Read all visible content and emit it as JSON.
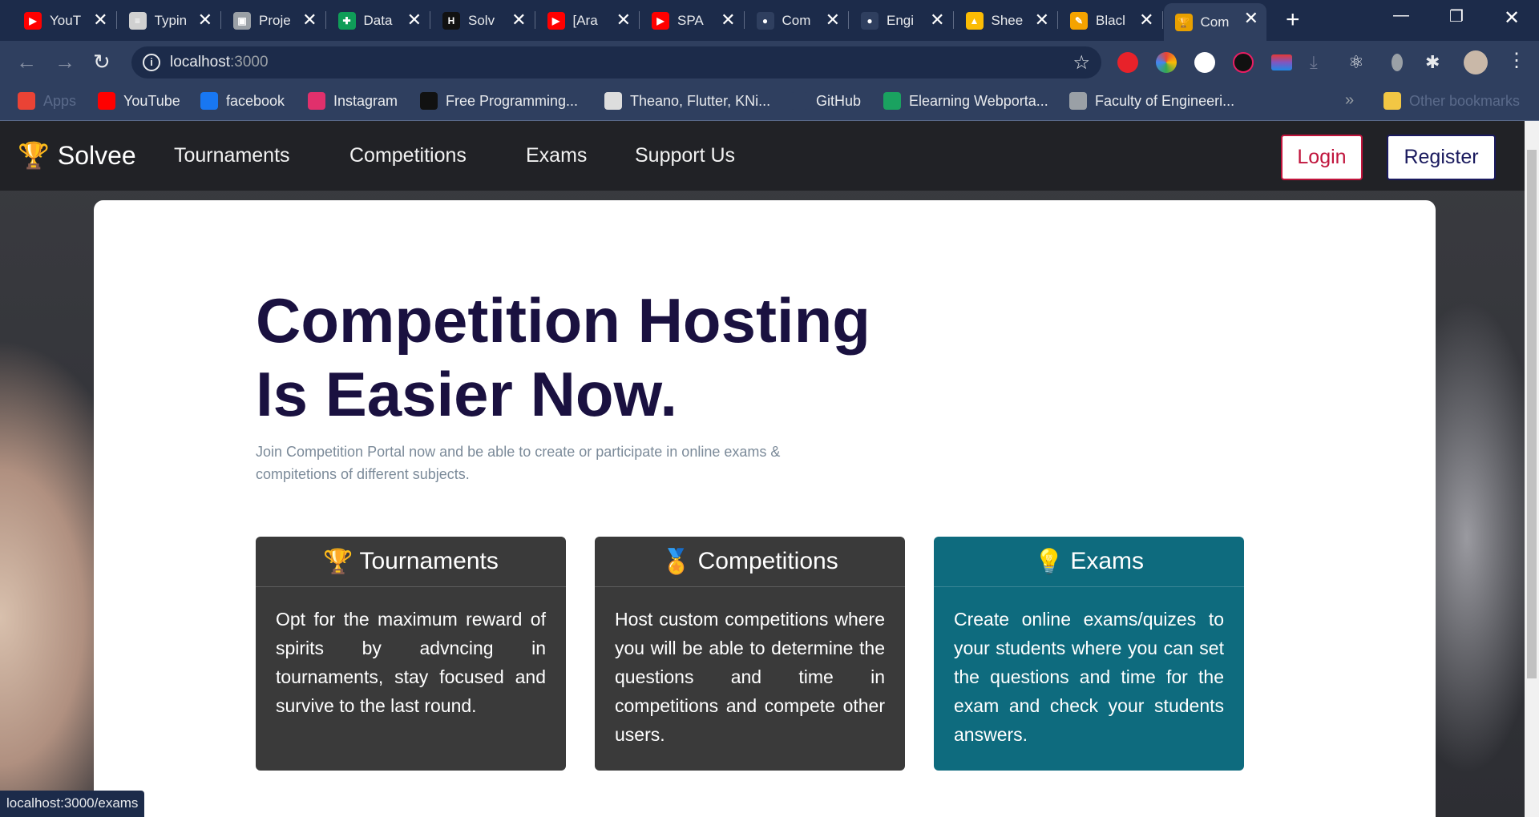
{
  "browser": {
    "tabs": [
      {
        "title": "YouT",
        "icon": "youtube-icon",
        "color": "#ff0000",
        "glyph": "▶"
      },
      {
        "title": "Typin",
        "icon": "typing-icon",
        "color": "#d0d0d0",
        "glyph": "≡"
      },
      {
        "title": "Proje",
        "icon": "project-icon",
        "color": "#9aa0a6",
        "glyph": "▣"
      },
      {
        "title": "Data",
        "icon": "sheets-icon",
        "color": "#0f9d58",
        "glyph": "✚"
      },
      {
        "title": "Solv",
        "icon": "solve-icon",
        "color": "#111111",
        "glyph": "H"
      },
      {
        "title": "[Ara",
        "icon": "youtube-icon",
        "color": "#ff0000",
        "glyph": "▶"
      },
      {
        "title": "SPA",
        "icon": "youtube-icon",
        "color": "#ff0000",
        "glyph": "▶"
      },
      {
        "title": "Com",
        "icon": "github-icon",
        "color": "#2f3f5f",
        "glyph": "●"
      },
      {
        "title": "Engi",
        "icon": "github-icon",
        "color": "#2f3f5f",
        "glyph": "●"
      },
      {
        "title": "Shee",
        "icon": "drive-icon",
        "color": "#fbbc04",
        "glyph": "▲"
      },
      {
        "title": "Blacl",
        "icon": "pencil-icon",
        "color": "#f4a300",
        "glyph": "✎"
      },
      {
        "title": "Com",
        "icon": "trophy-icon",
        "color": "#e8a000",
        "glyph": "🏆",
        "active": true
      }
    ],
    "url_host": "localhost",
    "url_port": ":3000",
    "bookmarks": [
      {
        "label": "Apps",
        "icon": "apps-grid-icon",
        "color": "#ea4335"
      },
      {
        "label": "YouTube",
        "icon": "youtube-icon",
        "color": "#ff0000"
      },
      {
        "label": "facebook",
        "icon": "facebook-icon",
        "color": "#1877f2"
      },
      {
        "label": "Instagram",
        "icon": "instagram-icon",
        "color": "#e1306c"
      },
      {
        "label": "Free Programming...",
        "icon": "bookmark-fp-icon",
        "color": "#111111"
      },
      {
        "label": "Theano, Flutter, KNi...",
        "icon": "bookmark-theano-icon",
        "color": "#dddddd"
      },
      {
        "label": "GitHub",
        "icon": "github-icon",
        "color": "#2f3f5f"
      },
      {
        "label": "Elearning Webporta...",
        "icon": "elearning-icon",
        "color": "#1aa260"
      },
      {
        "label": "Faculty of Engineeri...",
        "icon": "globe-icon",
        "color": "#9aa0a6"
      },
      {
        "label": "Other bookmarks",
        "icon": "folder-icon",
        "color": "#f2c744"
      }
    ],
    "overflow_label": "»",
    "status_url": "localhost:3000/exams"
  },
  "site": {
    "brand": "Solvee",
    "nav": [
      "Tournaments",
      "Competitions",
      "Exams",
      "Support Us"
    ],
    "login": "Login",
    "register": "Register",
    "headline_1": "Competition Hosting",
    "headline_2": "Is Easier Now.",
    "subline": "Join Competition Portal now and be able to create or participate in online exams & compitetions of different subjects.",
    "features": [
      {
        "title": "Tournaments",
        "icon": "trophy-icon",
        "glyph": "🏆",
        "text": "Opt for the maximum reward of spirits by advncing in tournaments, stay focused and survive to the last round.",
        "color": "#3a3a3a"
      },
      {
        "title": "Competitions",
        "icon": "medal-icon",
        "glyph": "🏅",
        "text": "Host custom competitions where you will be able to determine the questions and time in competitions and compete other users.",
        "color": "#3a3a3a"
      },
      {
        "title": "Exams",
        "icon": "lightbulb-icon",
        "glyph": "💡",
        "text": "Create online exams/quizes to your students where you can set the questions and time for the exam and check your students answers.",
        "color": "#0e6b7e"
      }
    ]
  }
}
